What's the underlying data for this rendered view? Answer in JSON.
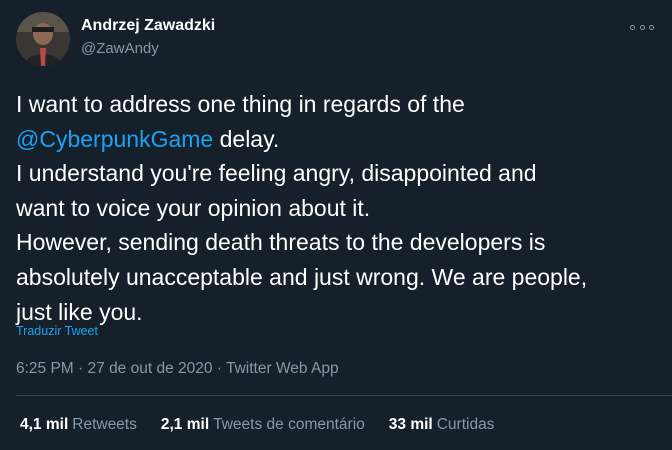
{
  "author": {
    "name": "Andrzej Zawadzki",
    "handle": "@ZawAndy"
  },
  "tweet": {
    "lines": [
      {
        "text": "I want to address one thing in regards of the"
      },
      {
        "mention": "@CyberpunkGame",
        "text": " delay."
      },
      {
        "text": "I understand you're feeling angry, disappointed and"
      },
      {
        "text": "want to voice your opinion about it."
      },
      {
        "text": "However, sending death threats to the developers is"
      },
      {
        "text": "absolutely unacceptable and just wrong. We are people,"
      },
      {
        "text": "just like you."
      }
    ]
  },
  "translate_label": "Traduzir Tweet",
  "meta": {
    "time": "6:25 PM",
    "date": "27 de out de 2020",
    "separator": " · ",
    "source": "Twitter Web App"
  },
  "stats": {
    "retweets": {
      "count": "4,1 mil",
      "label": "Retweets"
    },
    "quotes": {
      "count": "2,1 mil",
      "label": "Tweets de comentário"
    },
    "likes": {
      "count": "33 mil",
      "label": "Curtidas"
    }
  },
  "colors": {
    "background": "#15202b",
    "accent": "#1da1f2",
    "secondary_text": "#8899a6",
    "divider": "#38444d"
  },
  "icons": {
    "more": "more-horizontal-icon"
  }
}
